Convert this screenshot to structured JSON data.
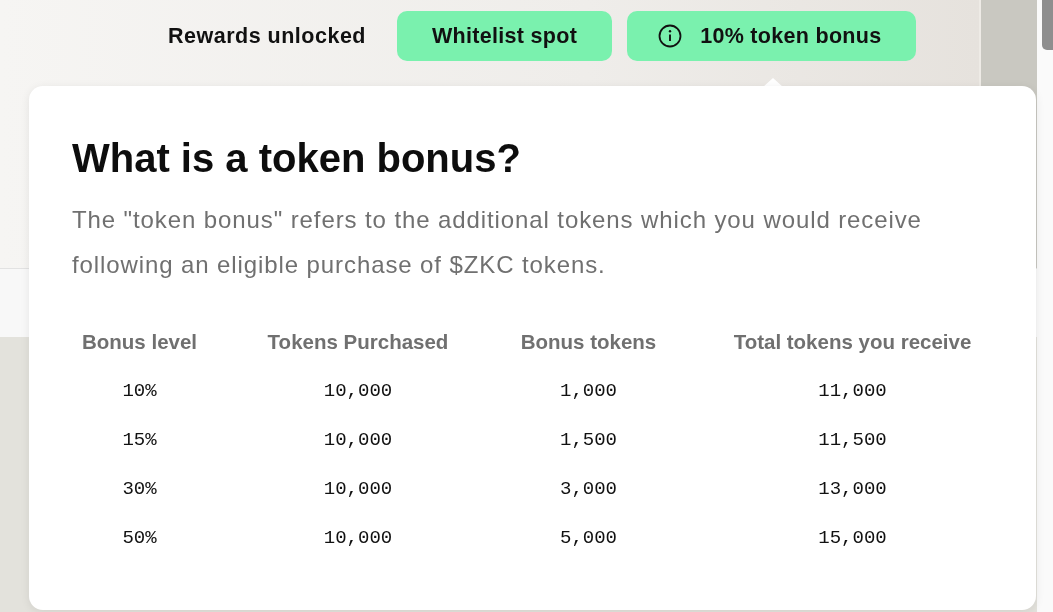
{
  "header": {
    "label": "Rewards unlocked",
    "badges": [
      {
        "kind": "tag",
        "label": "Whitelist spot"
      },
      {
        "kind": "info",
        "label": "10% token bonus"
      }
    ]
  },
  "popover": {
    "title": "What is a token bonus?",
    "text": "The \"token bonus\" refers to the additional tokens which you would receive following an eligible purchase of $ZKC tokens.",
    "table": {
      "columns": [
        "Bonus level",
        "Tokens Purchased",
        "Bonus tokens",
        "Total tokens you receive"
      ],
      "rows": [
        [
          "10%",
          "10,000",
          "1,000",
          "11,000"
        ],
        [
          "15%",
          "10,000",
          "1,500",
          "11,500"
        ],
        [
          "30%",
          "10,000",
          "3,000",
          "13,000"
        ],
        [
          "50%",
          "10,000",
          "5,000",
          "15,000"
        ]
      ]
    }
  }
}
